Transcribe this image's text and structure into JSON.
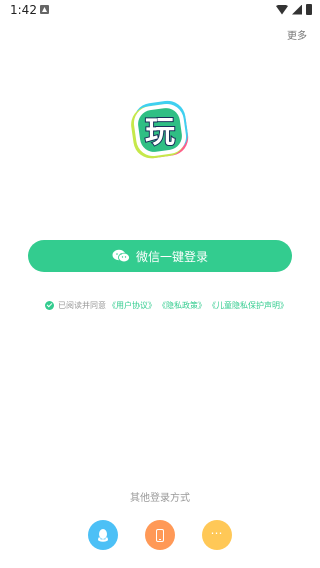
{
  "status_bar": {
    "time": "1:42"
  },
  "header": {
    "more_label": "更多"
  },
  "logo": {
    "glyph": "玩"
  },
  "login": {
    "wechat_button_label": "微信一键登录"
  },
  "agreement": {
    "prefix": "已阅读并同意",
    "links": [
      "《用户协议》",
      "《隐私政策》",
      "《儿童隐私保护声明》"
    ]
  },
  "other_login": {
    "label": "其他登录方式",
    "options": [
      {
        "icon": "qq-icon",
        "color": "#4cc0f6"
      },
      {
        "icon": "phone-icon",
        "color": "#ff9957"
      },
      {
        "icon": "more-dots-icon",
        "color": "#ffc857"
      }
    ]
  },
  "colors": {
    "accent": "#33cc8f"
  }
}
